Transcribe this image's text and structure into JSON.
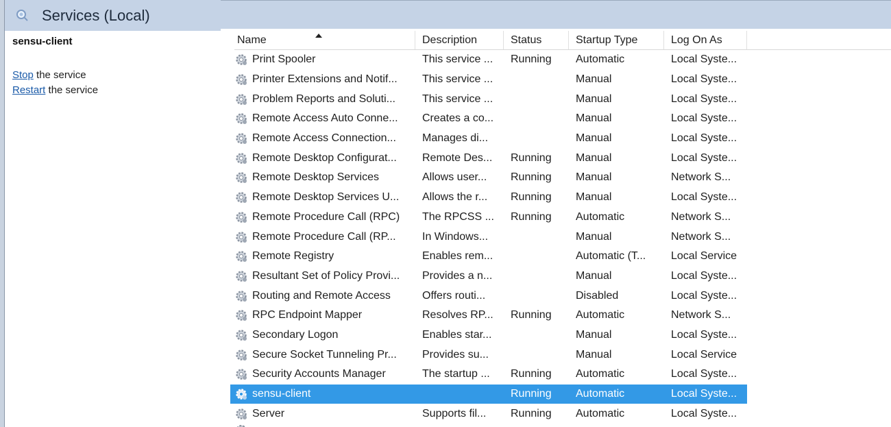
{
  "window": {
    "title": "Services (Local)"
  },
  "left_pane": {
    "service_name": "sensu-client",
    "stop_link": "Stop",
    "stop_suffix": " the service",
    "restart_link": "Restart",
    "restart_suffix": " the service"
  },
  "columns": {
    "name": "Name",
    "description": "Description",
    "status": "Status",
    "startup_type": "Startup Type",
    "log_on_as": "Log On As"
  },
  "rows": [
    {
      "name": "Print Spooler",
      "description": "This service ...",
      "status": "Running",
      "startup": "Automatic",
      "logon": "Local Syste..."
    },
    {
      "name": "Printer Extensions and Notif...",
      "description": "This service ...",
      "status": "",
      "startup": "Manual",
      "logon": "Local Syste..."
    },
    {
      "name": "Problem Reports and Soluti...",
      "description": "This service ...",
      "status": "",
      "startup": "Manual",
      "logon": "Local Syste..."
    },
    {
      "name": "Remote Access Auto Conne...",
      "description": "Creates a co...",
      "status": "",
      "startup": "Manual",
      "logon": "Local Syste..."
    },
    {
      "name": "Remote Access Connection...",
      "description": "Manages di...",
      "status": "",
      "startup": "Manual",
      "logon": "Local Syste..."
    },
    {
      "name": "Remote Desktop Configurat...",
      "description": "Remote Des...",
      "status": "Running",
      "startup": "Manual",
      "logon": "Local Syste..."
    },
    {
      "name": "Remote Desktop Services",
      "description": "Allows user...",
      "status": "Running",
      "startup": "Manual",
      "logon": "Network S..."
    },
    {
      "name": "Remote Desktop Services U...",
      "description": "Allows the r...",
      "status": "Running",
      "startup": "Manual",
      "logon": "Local Syste..."
    },
    {
      "name": "Remote Procedure Call (RPC)",
      "description": "The RPCSS ...",
      "status": "Running",
      "startup": "Automatic",
      "logon": "Network S..."
    },
    {
      "name": "Remote Procedure Call (RP...",
      "description": "In Windows...",
      "status": "",
      "startup": "Manual",
      "logon": "Network S..."
    },
    {
      "name": "Remote Registry",
      "description": "Enables rem...",
      "status": "",
      "startup": "Automatic (T...",
      "logon": "Local Service"
    },
    {
      "name": "Resultant Set of Policy Provi...",
      "description": "Provides a n...",
      "status": "",
      "startup": "Manual",
      "logon": "Local Syste..."
    },
    {
      "name": "Routing and Remote Access",
      "description": "Offers routi...",
      "status": "",
      "startup": "Disabled",
      "logon": "Local Syste..."
    },
    {
      "name": "RPC Endpoint Mapper",
      "description": "Resolves RP...",
      "status": "Running",
      "startup": "Automatic",
      "logon": "Network S..."
    },
    {
      "name": "Secondary Logon",
      "description": "Enables star...",
      "status": "",
      "startup": "Manual",
      "logon": "Local Syste..."
    },
    {
      "name": "Secure Socket Tunneling Pr...",
      "description": "Provides su...",
      "status": "",
      "startup": "Manual",
      "logon": "Local Service"
    },
    {
      "name": "Security Accounts Manager",
      "description": "The startup ...",
      "status": "Running",
      "startup": "Automatic",
      "logon": "Local Syste..."
    },
    {
      "name": "sensu-client",
      "description": "",
      "status": "Running",
      "startup": "Automatic",
      "logon": "Local Syste...",
      "selected": true
    },
    {
      "name": "Server",
      "description": "Supports fil...",
      "status": "Running",
      "startup": "Automatic",
      "logon": "Local Syste..."
    }
  ],
  "colors": {
    "selection": "#3399e6",
    "header_band": "#c5d3e6",
    "link": "#1a5aa8"
  }
}
